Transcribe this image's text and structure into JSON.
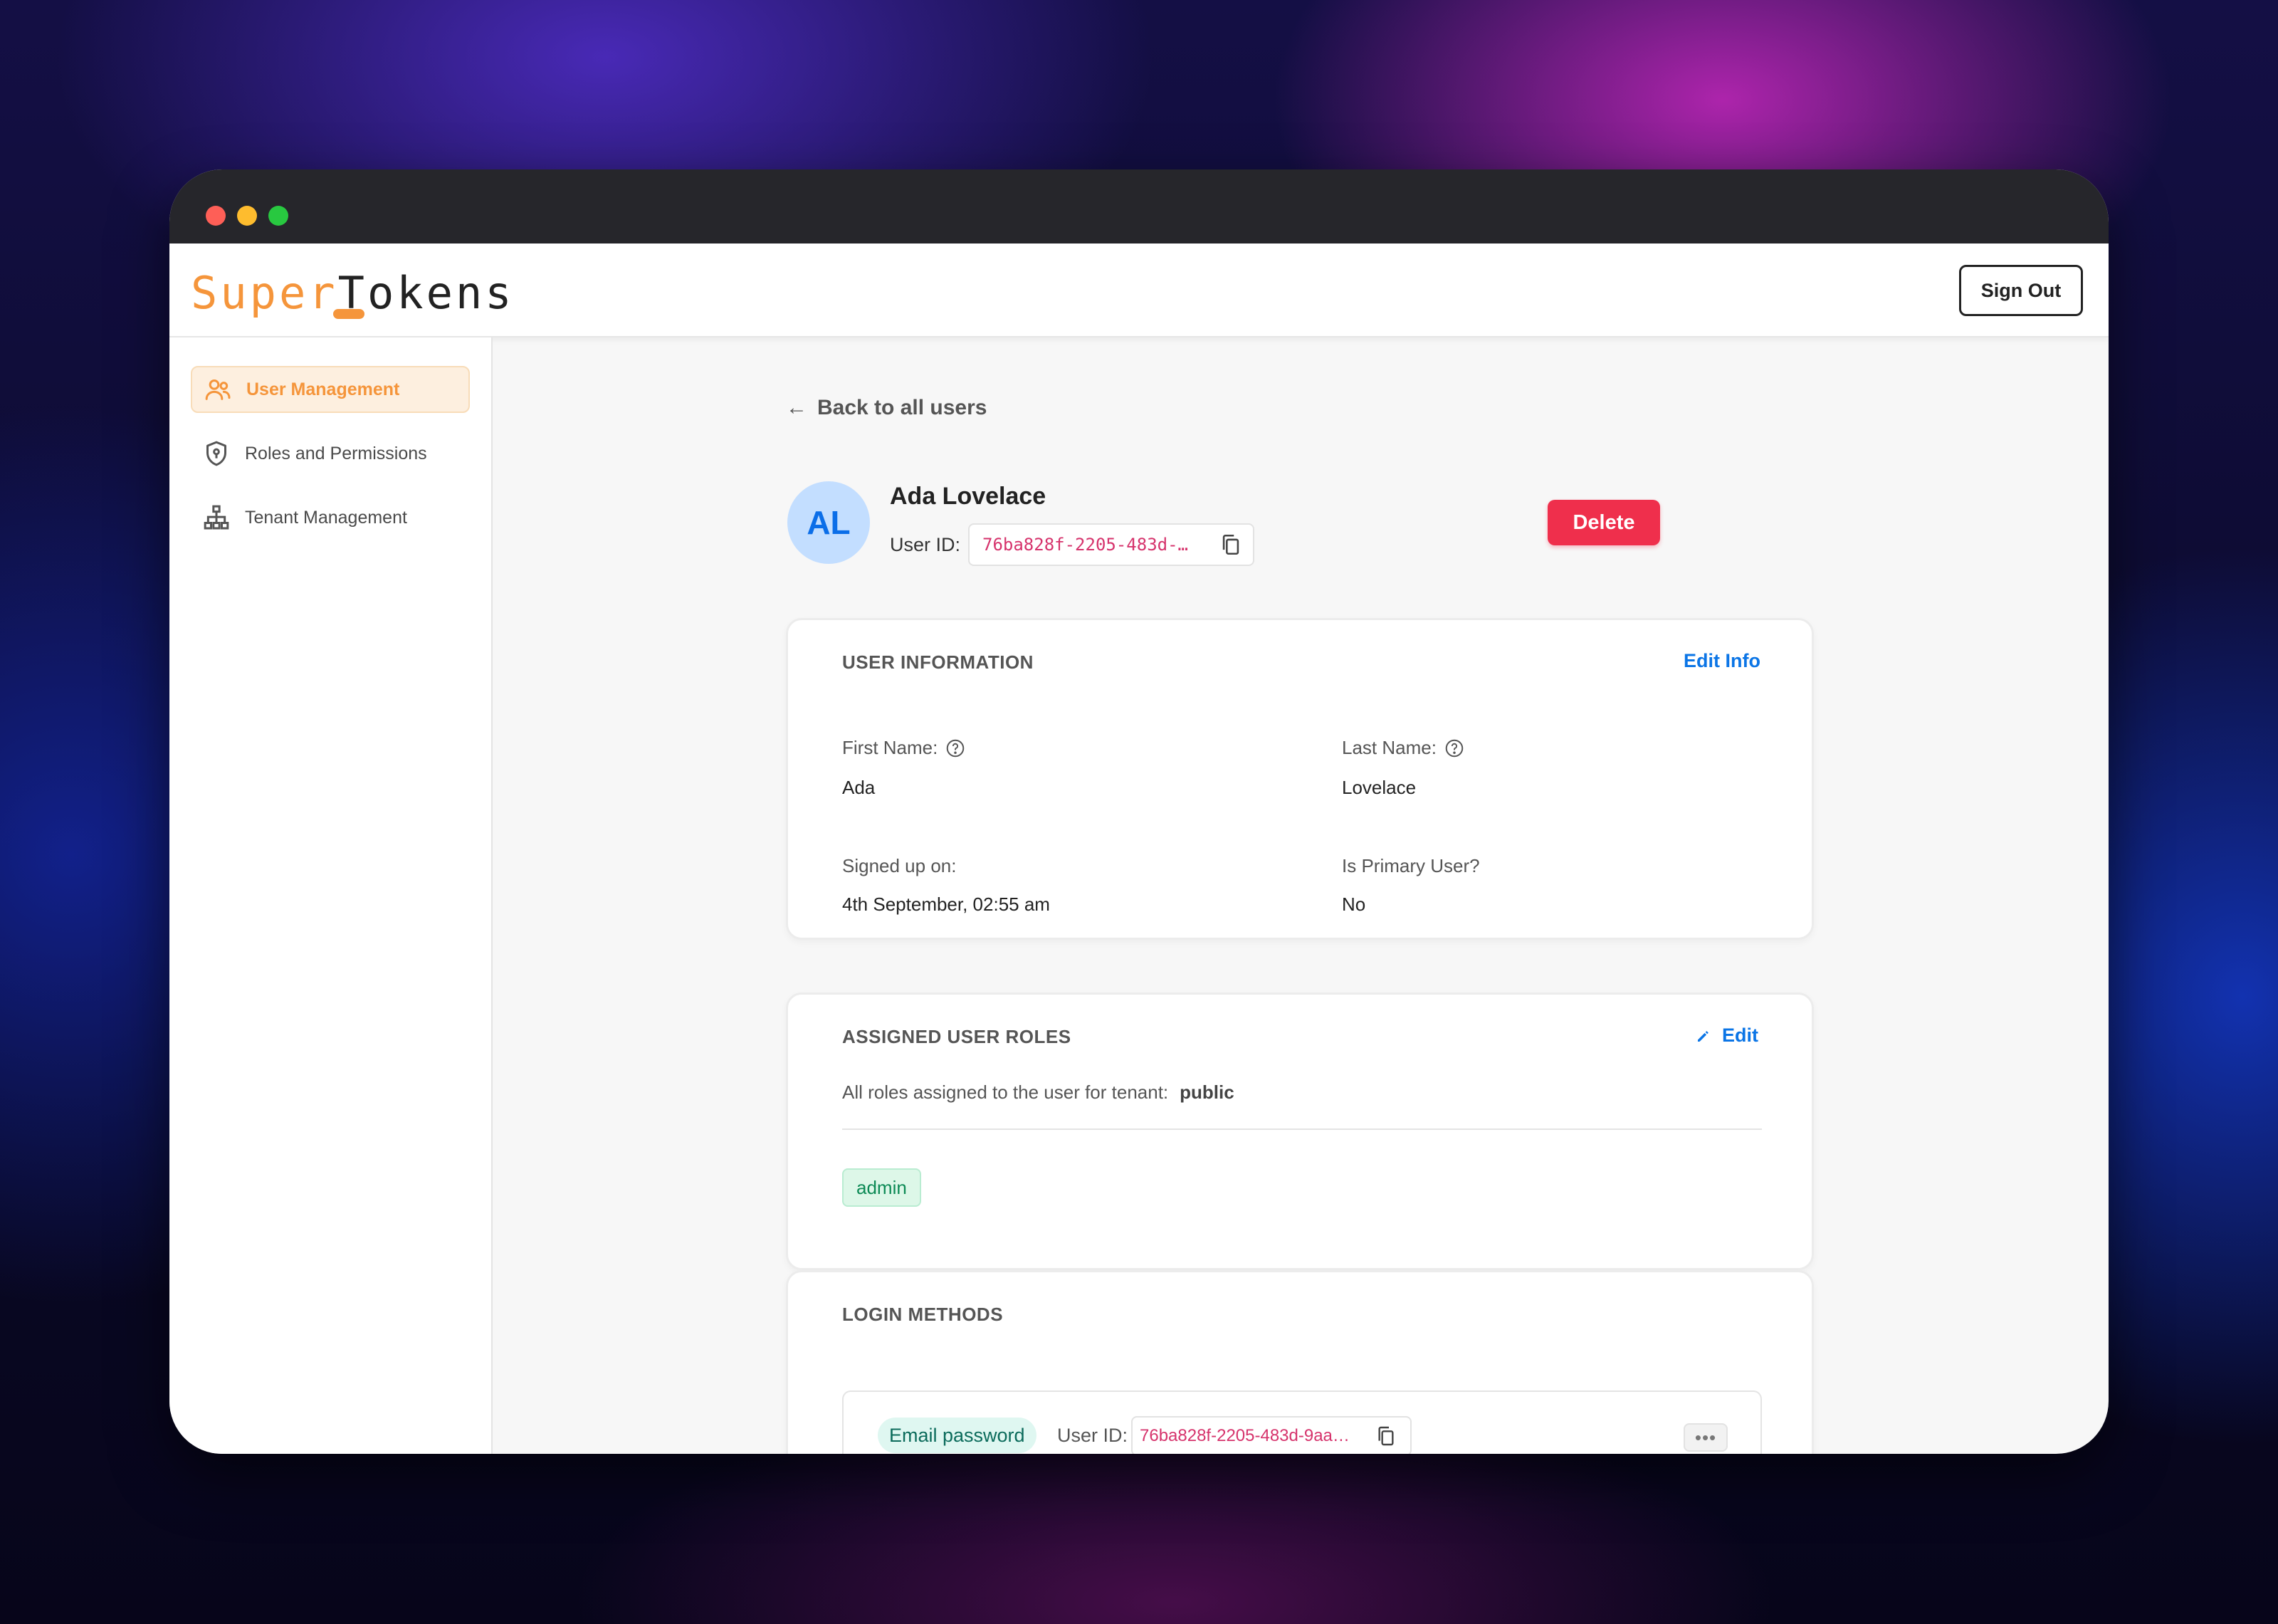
{
  "window": {
    "controls": [
      "close",
      "minimize",
      "maximize"
    ]
  },
  "header": {
    "logo_super": "Super",
    "logo_tokens": "Tokens",
    "sign_out_label": "Sign Out"
  },
  "sidebar": {
    "items": [
      {
        "label": "User Management",
        "icon": "users-icon",
        "active": true
      },
      {
        "label": "Roles and Permissions",
        "icon": "shield-icon",
        "active": false
      },
      {
        "label": "Tenant Management",
        "icon": "hierarchy-icon",
        "active": false
      }
    ]
  },
  "user": {
    "back_label": "Back to all users",
    "initials": "AL",
    "name": "Ada Lovelace",
    "user_id_label": "User ID:",
    "user_id_value": "76ba828f-2205-483d-…",
    "delete_label": "Delete"
  },
  "user_info": {
    "title": "USER INFORMATION",
    "edit_label": "Edit Info",
    "first_name_label": "First Name:",
    "first_name_value": "Ada",
    "last_name_label": "Last Name:",
    "last_name_value": "Lovelace",
    "signed_up_label": "Signed up on:",
    "signed_up_value": "4th September, 02:55 am",
    "primary_label": "Is Primary User?",
    "primary_value": "No"
  },
  "roles": {
    "title": "ASSIGNED USER ROLES",
    "edit_label": "Edit",
    "subtitle": "All roles assigned to the user for tenant:",
    "tenant": "public",
    "assigned": [
      "admin"
    ]
  },
  "login_methods": {
    "title": "LOGIN METHODS",
    "method_label": "Email password",
    "user_id_label": "User ID:",
    "user_id_value": "76ba828f-2205-483d-9aa…",
    "more_label": "•••"
  },
  "colors": {
    "brand_orange": "#f5953b",
    "link_blue": "#0b75e6",
    "danger_red": "#ef2f4c",
    "id_pink": "#d6336c",
    "role_green": "#0c8a55"
  }
}
